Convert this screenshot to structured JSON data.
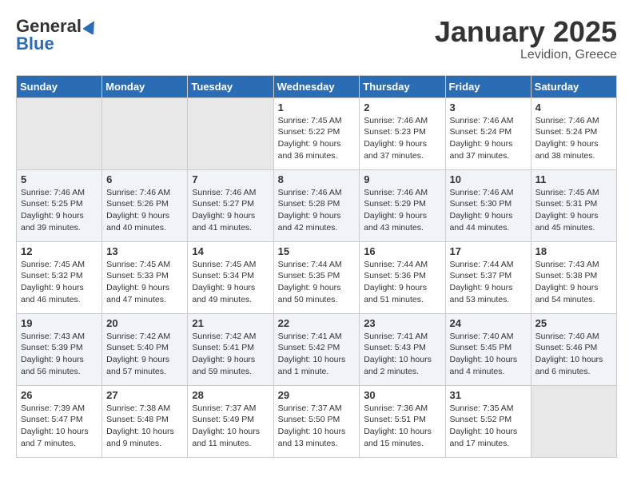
{
  "header": {
    "logo_general": "General",
    "logo_blue": "Blue",
    "month": "January 2025",
    "location": "Levidion, Greece"
  },
  "weekdays": [
    "Sunday",
    "Monday",
    "Tuesday",
    "Wednesday",
    "Thursday",
    "Friday",
    "Saturday"
  ],
  "weeks": [
    [
      {
        "day": "",
        "info": ""
      },
      {
        "day": "",
        "info": ""
      },
      {
        "day": "",
        "info": ""
      },
      {
        "day": "1",
        "info": "Sunrise: 7:45 AM\nSunset: 5:22 PM\nDaylight: 9 hours and 36 minutes."
      },
      {
        "day": "2",
        "info": "Sunrise: 7:46 AM\nSunset: 5:23 PM\nDaylight: 9 hours and 37 minutes."
      },
      {
        "day": "3",
        "info": "Sunrise: 7:46 AM\nSunset: 5:24 PM\nDaylight: 9 hours and 37 minutes."
      },
      {
        "day": "4",
        "info": "Sunrise: 7:46 AM\nSunset: 5:24 PM\nDaylight: 9 hours and 38 minutes."
      }
    ],
    [
      {
        "day": "5",
        "info": "Sunrise: 7:46 AM\nSunset: 5:25 PM\nDaylight: 9 hours and 39 minutes."
      },
      {
        "day": "6",
        "info": "Sunrise: 7:46 AM\nSunset: 5:26 PM\nDaylight: 9 hours and 40 minutes."
      },
      {
        "day": "7",
        "info": "Sunrise: 7:46 AM\nSunset: 5:27 PM\nDaylight: 9 hours and 41 minutes."
      },
      {
        "day": "8",
        "info": "Sunrise: 7:46 AM\nSunset: 5:28 PM\nDaylight: 9 hours and 42 minutes."
      },
      {
        "day": "9",
        "info": "Sunrise: 7:46 AM\nSunset: 5:29 PM\nDaylight: 9 hours and 43 minutes."
      },
      {
        "day": "10",
        "info": "Sunrise: 7:46 AM\nSunset: 5:30 PM\nDaylight: 9 hours and 44 minutes."
      },
      {
        "day": "11",
        "info": "Sunrise: 7:45 AM\nSunset: 5:31 PM\nDaylight: 9 hours and 45 minutes."
      }
    ],
    [
      {
        "day": "12",
        "info": "Sunrise: 7:45 AM\nSunset: 5:32 PM\nDaylight: 9 hours and 46 minutes."
      },
      {
        "day": "13",
        "info": "Sunrise: 7:45 AM\nSunset: 5:33 PM\nDaylight: 9 hours and 47 minutes."
      },
      {
        "day": "14",
        "info": "Sunrise: 7:45 AM\nSunset: 5:34 PM\nDaylight: 9 hours and 49 minutes."
      },
      {
        "day": "15",
        "info": "Sunrise: 7:44 AM\nSunset: 5:35 PM\nDaylight: 9 hours and 50 minutes."
      },
      {
        "day": "16",
        "info": "Sunrise: 7:44 AM\nSunset: 5:36 PM\nDaylight: 9 hours and 51 minutes."
      },
      {
        "day": "17",
        "info": "Sunrise: 7:44 AM\nSunset: 5:37 PM\nDaylight: 9 hours and 53 minutes."
      },
      {
        "day": "18",
        "info": "Sunrise: 7:43 AM\nSunset: 5:38 PM\nDaylight: 9 hours and 54 minutes."
      }
    ],
    [
      {
        "day": "19",
        "info": "Sunrise: 7:43 AM\nSunset: 5:39 PM\nDaylight: 9 hours and 56 minutes."
      },
      {
        "day": "20",
        "info": "Sunrise: 7:42 AM\nSunset: 5:40 PM\nDaylight: 9 hours and 57 minutes."
      },
      {
        "day": "21",
        "info": "Sunrise: 7:42 AM\nSunset: 5:41 PM\nDaylight: 9 hours and 59 minutes."
      },
      {
        "day": "22",
        "info": "Sunrise: 7:41 AM\nSunset: 5:42 PM\nDaylight: 10 hours and 1 minute."
      },
      {
        "day": "23",
        "info": "Sunrise: 7:41 AM\nSunset: 5:43 PM\nDaylight: 10 hours and 2 minutes."
      },
      {
        "day": "24",
        "info": "Sunrise: 7:40 AM\nSunset: 5:45 PM\nDaylight: 10 hours and 4 minutes."
      },
      {
        "day": "25",
        "info": "Sunrise: 7:40 AM\nSunset: 5:46 PM\nDaylight: 10 hours and 6 minutes."
      }
    ],
    [
      {
        "day": "26",
        "info": "Sunrise: 7:39 AM\nSunset: 5:47 PM\nDaylight: 10 hours and 7 minutes."
      },
      {
        "day": "27",
        "info": "Sunrise: 7:38 AM\nSunset: 5:48 PM\nDaylight: 10 hours and 9 minutes."
      },
      {
        "day": "28",
        "info": "Sunrise: 7:37 AM\nSunset: 5:49 PM\nDaylight: 10 hours and 11 minutes."
      },
      {
        "day": "29",
        "info": "Sunrise: 7:37 AM\nSunset: 5:50 PM\nDaylight: 10 hours and 13 minutes."
      },
      {
        "day": "30",
        "info": "Sunrise: 7:36 AM\nSunset: 5:51 PM\nDaylight: 10 hours and 15 minutes."
      },
      {
        "day": "31",
        "info": "Sunrise: 7:35 AM\nSunset: 5:52 PM\nDaylight: 10 hours and 17 minutes."
      },
      {
        "day": "",
        "info": ""
      }
    ]
  ]
}
